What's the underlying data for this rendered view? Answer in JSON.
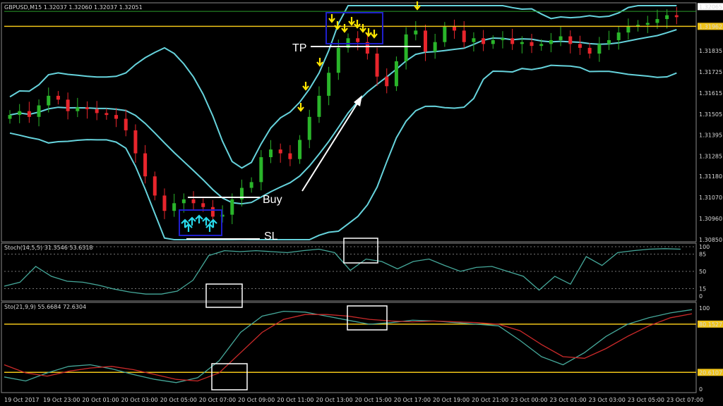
{
  "colors": {
    "background": "#000000",
    "band": "#66d3dc",
    "bull": "#2ab52a",
    "bear": "#e8252c",
    "level": "#f0c419",
    "stoch_main": "#45a89a",
    "stoch_signal": "#cc2a2a",
    "arrow_down": "#ffe600",
    "arrow_up": "#28d9ea",
    "box_blue": "#1f1fcc",
    "box_white": "#ffffff",
    "annotation": "#ffffff"
  },
  "header": {
    "symbol_line": "GBPUSD,M15 1.32037 1.32060 1.32037 1.32051",
    "stoch1_label": "Stoch(14,5,5) 31.3546 53.6318",
    "stoch2_label": "Sto(21,9,9) 55.6684 72.6304"
  },
  "annotations": {
    "tp": "TP",
    "buy": "Buy",
    "sl": "SL"
  },
  "chart_data": [
    {
      "type": "candlestick",
      "panel": "price",
      "indicators": [
        "Bollinger Bands"
      ],
      "y_ticks": [
        "1.32065",
        "1.31962",
        "1.31835",
        "1.31725",
        "1.31615",
        "1.31505",
        "1.31395",
        "1.31285",
        "1.31180",
        "1.31070",
        "1.30960",
        "1.30850"
      ],
      "price_labels_highlighted": [
        "1.32065",
        "1.31962"
      ],
      "horizontal_levels": [
        1.31962
      ],
      "ylim": [
        1.3085,
        1.3207
      ],
      "x_ticks": [
        "19 Oct 2017",
        "19 Oct 23:00",
        "20 Oct 01:00",
        "20 Oct 03:00",
        "20 Oct 05:00",
        "20 Oct 07:00",
        "20 Oct 09:00",
        "20 Oct 11:00",
        "20 Oct 13:00",
        "20 Oct 15:00",
        "20 Oct 17:00",
        "20 Oct 19:00",
        "20 Oct 21:00",
        "23 Oct 00:00",
        "23 Oct 01:00",
        "23 Oct 03:00",
        "23 Oct 05:00",
        "23 Oct 07:00"
      ],
      "closes": [
        1.315,
        1.3152,
        1.3149,
        1.3155,
        1.316,
        1.3158,
        1.3152,
        1.3154,
        1.3153,
        1.3151,
        1.315,
        1.3148,
        1.3142,
        1.313,
        1.3118,
        1.3108,
        1.31,
        1.3104,
        1.3106,
        1.3104,
        1.3102,
        1.3097,
        1.3098,
        1.3106,
        1.3112,
        1.3115,
        1.3128,
        1.3132,
        1.313,
        1.3127,
        1.3137,
        1.3149,
        1.316,
        1.3172,
        1.3185,
        1.319,
        1.3188,
        1.3182,
        1.317,
        1.3165,
        1.3178,
        1.3192,
        1.3194,
        1.3183,
        1.3188,
        1.3196,
        1.3194,
        1.3188,
        1.319,
        1.3187,
        1.3189,
        1.319,
        1.3187,
        1.3188,
        1.3186,
        1.3187,
        1.3189,
        1.3191,
        1.3187,
        1.3185,
        1.3182,
        1.3187,
        1.3189,
        1.3193,
        1.3196,
        1.3197,
        1.3198,
        1.32,
        1.3202,
        1.3201
      ]
    },
    {
      "type": "line",
      "panel": "stoch1",
      "title": "Stoch(14,5,5) 31.3546 53.6318",
      "y_ticks": [
        "100",
        "85",
        "50",
        "15",
        "0"
      ],
      "ylim": [
        0,
        100
      ],
      "series": [
        {
          "name": "main",
          "values": [
            20,
            28,
            60,
            40,
            30,
            28,
            22,
            14,
            8,
            4,
            4,
            10,
            32,
            82,
            92,
            90,
            92,
            90,
            88,
            92,
            95,
            88,
            52,
            75,
            70,
            55,
            70,
            75,
            62,
            50,
            58,
            60,
            50,
            40,
            12,
            40,
            24,
            80,
            62,
            88,
            92,
            95,
            96,
            95
          ]
        }
      ]
    },
    {
      "type": "line",
      "panel": "stoch2",
      "title": "Sto(21,9,9) 55.6684 72.6304",
      "y_ticks": [
        "100",
        "80.1527",
        "20.6107",
        "0"
      ],
      "horizontal_levels": [
        80.1527,
        20.6107
      ],
      "ylim": [
        0,
        100
      ],
      "series": [
        {
          "name": "main",
          "values": [
            15,
            10,
            20,
            28,
            30,
            25,
            18,
            12,
            8,
            14,
            35,
            70,
            90,
            96,
            95,
            90,
            85,
            80,
            82,
            85,
            84,
            82,
            80,
            78,
            60,
            40,
            30,
            45,
            65,
            80,
            88,
            94,
            98
          ]
        },
        {
          "name": "signal",
          "values": [
            30,
            20,
            16,
            22,
            26,
            28,
            24,
            18,
            12,
            10,
            20,
            45,
            70,
            86,
            92,
            92,
            90,
            86,
            84,
            83,
            84,
            83,
            82,
            80,
            72,
            55,
            40,
            38,
            50,
            65,
            78,
            88,
            93
          ]
        }
      ]
    }
  ]
}
